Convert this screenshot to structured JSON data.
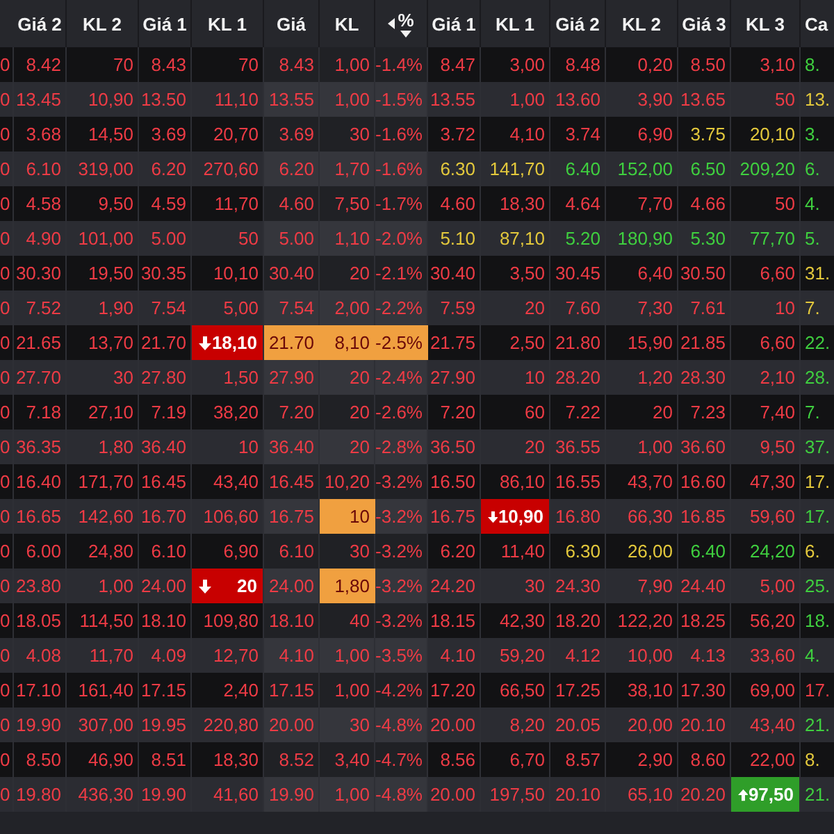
{
  "columns": [
    {},
    {
      "label": "Giá 2"
    },
    {
      "label": "KL 2"
    },
    {
      "label": "Giá 1"
    },
    {
      "label": "KL 1"
    },
    {
      "label": "Giá"
    },
    {
      "label": "KL"
    },
    {
      "label": "%",
      "sorted": true
    },
    {
      "label": "Giá 1"
    },
    {
      "label": "KL 1"
    },
    {
      "label": "Giá 2"
    },
    {
      "label": "KL 2"
    },
    {
      "label": "Giá 3"
    },
    {
      "label": "KL 3"
    },
    {
      "label": "Ca"
    }
  ],
  "rows": [
    {
      "cells": [
        {
          "text": "0",
          "kind": "down"
        },
        {
          "text": "8.42",
          "kind": "down"
        },
        {
          "text": "70",
          "kind": "down"
        },
        {
          "text": "8.43",
          "kind": "down"
        },
        {
          "text": "70",
          "kind": "down"
        },
        {
          "text": "8.43",
          "kind": "down"
        },
        {
          "text": "1,00",
          "kind": "down"
        },
        {
          "text": "-1.4%",
          "kind": "down"
        },
        {
          "text": "8.47",
          "kind": "down"
        },
        {
          "text": "3,00",
          "kind": "down"
        },
        {
          "text": "8.48",
          "kind": "down"
        },
        {
          "text": "0,20",
          "kind": "down"
        },
        {
          "text": "8.50",
          "kind": "down"
        },
        {
          "text": "3,10",
          "kind": "down"
        },
        {
          "text": "8.",
          "kind": "up"
        }
      ]
    },
    {
      "cells": [
        {
          "text": "0",
          "kind": "down"
        },
        {
          "text": "13.45",
          "kind": "down"
        },
        {
          "text": "10,90",
          "kind": "down"
        },
        {
          "text": "13.50",
          "kind": "down"
        },
        {
          "text": "11,10",
          "kind": "down"
        },
        {
          "text": "13.55",
          "kind": "down"
        },
        {
          "text": "1,00",
          "kind": "down"
        },
        {
          "text": "-1.5%",
          "kind": "down"
        },
        {
          "text": "13.55",
          "kind": "down"
        },
        {
          "text": "1,00",
          "kind": "down"
        },
        {
          "text": "13.60",
          "kind": "down"
        },
        {
          "text": "3,90",
          "kind": "down"
        },
        {
          "text": "13.65",
          "kind": "down"
        },
        {
          "text": "50",
          "kind": "down"
        },
        {
          "text": "13.",
          "kind": "ref"
        }
      ]
    },
    {
      "cells": [
        {
          "text": "0",
          "kind": "down"
        },
        {
          "text": "3.68",
          "kind": "down"
        },
        {
          "text": "14,50",
          "kind": "down"
        },
        {
          "text": "3.69",
          "kind": "down"
        },
        {
          "text": "20,70",
          "kind": "down"
        },
        {
          "text": "3.69",
          "kind": "down"
        },
        {
          "text": "30",
          "kind": "down"
        },
        {
          "text": "-1.6%",
          "kind": "down"
        },
        {
          "text": "3.72",
          "kind": "down"
        },
        {
          "text": "4,10",
          "kind": "down"
        },
        {
          "text": "3.74",
          "kind": "down"
        },
        {
          "text": "6,90",
          "kind": "down"
        },
        {
          "text": "3.75",
          "kind": "ref"
        },
        {
          "text": "20,10",
          "kind": "ref"
        },
        {
          "text": "3.",
          "kind": "up"
        }
      ]
    },
    {
      "cells": [
        {
          "text": "0",
          "kind": "down"
        },
        {
          "text": "6.10",
          "kind": "down"
        },
        {
          "text": "319,00",
          "kind": "down"
        },
        {
          "text": "6.20",
          "kind": "down"
        },
        {
          "text": "270,60",
          "kind": "down"
        },
        {
          "text": "6.20",
          "kind": "down"
        },
        {
          "text": "1,70",
          "kind": "down"
        },
        {
          "text": "-1.6%",
          "kind": "down"
        },
        {
          "text": "6.30",
          "kind": "ref"
        },
        {
          "text": "141,70",
          "kind": "ref"
        },
        {
          "text": "6.40",
          "kind": "up"
        },
        {
          "text": "152,00",
          "kind": "up"
        },
        {
          "text": "6.50",
          "kind": "up"
        },
        {
          "text": "209,20",
          "kind": "up"
        },
        {
          "text": "6.",
          "kind": "up"
        }
      ]
    },
    {
      "cells": [
        {
          "text": "0",
          "kind": "down"
        },
        {
          "text": "4.58",
          "kind": "down"
        },
        {
          "text": "9,50",
          "kind": "down"
        },
        {
          "text": "4.59",
          "kind": "down"
        },
        {
          "text": "11,70",
          "kind": "down"
        },
        {
          "text": "4.60",
          "kind": "down"
        },
        {
          "text": "7,50",
          "kind": "down"
        },
        {
          "text": "-1.7%",
          "kind": "down"
        },
        {
          "text": "4.60",
          "kind": "down"
        },
        {
          "text": "18,30",
          "kind": "down"
        },
        {
          "text": "4.64",
          "kind": "down"
        },
        {
          "text": "7,70",
          "kind": "down"
        },
        {
          "text": "4.66",
          "kind": "down"
        },
        {
          "text": "50",
          "kind": "down"
        },
        {
          "text": "4.",
          "kind": "up"
        }
      ]
    },
    {
      "cells": [
        {
          "text": "0",
          "kind": "down"
        },
        {
          "text": "4.90",
          "kind": "down"
        },
        {
          "text": "101,00",
          "kind": "down"
        },
        {
          "text": "5.00",
          "kind": "down"
        },
        {
          "text": "50",
          "kind": "down"
        },
        {
          "text": "5.00",
          "kind": "down"
        },
        {
          "text": "1,10",
          "kind": "down"
        },
        {
          "text": "-2.0%",
          "kind": "down"
        },
        {
          "text": "5.10",
          "kind": "ref"
        },
        {
          "text": "87,10",
          "kind": "ref"
        },
        {
          "text": "5.20",
          "kind": "up"
        },
        {
          "text": "180,90",
          "kind": "up"
        },
        {
          "text": "5.30",
          "kind": "up"
        },
        {
          "text": "77,70",
          "kind": "up"
        },
        {
          "text": "5.",
          "kind": "up"
        }
      ]
    },
    {
      "cells": [
        {
          "text": "0",
          "kind": "down"
        },
        {
          "text": "30.30",
          "kind": "down"
        },
        {
          "text": "19,50",
          "kind": "down"
        },
        {
          "text": "30.35",
          "kind": "down"
        },
        {
          "text": "10,10",
          "kind": "down"
        },
        {
          "text": "30.40",
          "kind": "down"
        },
        {
          "text": "20",
          "kind": "down"
        },
        {
          "text": "-2.1%",
          "kind": "down"
        },
        {
          "text": "30.40",
          "kind": "down"
        },
        {
          "text": "3,50",
          "kind": "down"
        },
        {
          "text": "30.45",
          "kind": "down"
        },
        {
          "text": "6,40",
          "kind": "down"
        },
        {
          "text": "30.50",
          "kind": "down"
        },
        {
          "text": "6,60",
          "kind": "down"
        },
        {
          "text": "31.",
          "kind": "ref"
        }
      ]
    },
    {
      "cells": [
        {
          "text": "0",
          "kind": "down"
        },
        {
          "text": "7.52",
          "kind": "down"
        },
        {
          "text": "1,90",
          "kind": "down"
        },
        {
          "text": "7.54",
          "kind": "down"
        },
        {
          "text": "5,00",
          "kind": "down"
        },
        {
          "text": "7.54",
          "kind": "down"
        },
        {
          "text": "2,00",
          "kind": "down"
        },
        {
          "text": "-2.2%",
          "kind": "down"
        },
        {
          "text": "7.59",
          "kind": "down"
        },
        {
          "text": "20",
          "kind": "down"
        },
        {
          "text": "7.60",
          "kind": "down"
        },
        {
          "text": "7,30",
          "kind": "down"
        },
        {
          "text": "7.61",
          "kind": "down"
        },
        {
          "text": "10",
          "kind": "down"
        },
        {
          "text": "7.",
          "kind": "ref"
        }
      ]
    },
    {
      "cells": [
        {
          "text": "0",
          "kind": "down"
        },
        {
          "text": "21.65",
          "kind": "down"
        },
        {
          "text": "13,70",
          "kind": "down"
        },
        {
          "text": "21.70",
          "kind": "down"
        },
        {
          "text": "18,10",
          "kind": "sellflash"
        },
        {
          "text": "21.70",
          "kind": "matched"
        },
        {
          "text": "8,10",
          "kind": "matched"
        },
        {
          "text": "-2.5%",
          "kind": "matched"
        },
        {
          "text": "21.75",
          "kind": "down"
        },
        {
          "text": "2,50",
          "kind": "down"
        },
        {
          "text": "21.80",
          "kind": "down"
        },
        {
          "text": "15,90",
          "kind": "down"
        },
        {
          "text": "21.85",
          "kind": "down"
        },
        {
          "text": "6,60",
          "kind": "down"
        },
        {
          "text": "22.",
          "kind": "up"
        }
      ]
    },
    {
      "cells": [
        {
          "text": "0",
          "kind": "down"
        },
        {
          "text": "27.70",
          "kind": "down"
        },
        {
          "text": "30",
          "kind": "down"
        },
        {
          "text": "27.80",
          "kind": "down"
        },
        {
          "text": "1,50",
          "kind": "down"
        },
        {
          "text": "27.90",
          "kind": "down"
        },
        {
          "text": "20",
          "kind": "down"
        },
        {
          "text": "-2.4%",
          "kind": "down"
        },
        {
          "text": "27.90",
          "kind": "down"
        },
        {
          "text": "10",
          "kind": "down"
        },
        {
          "text": "28.20",
          "kind": "down"
        },
        {
          "text": "1,20",
          "kind": "down"
        },
        {
          "text": "28.30",
          "kind": "down"
        },
        {
          "text": "2,10",
          "kind": "down"
        },
        {
          "text": "28.",
          "kind": "up"
        }
      ]
    },
    {
      "cells": [
        {
          "text": "0",
          "kind": "down"
        },
        {
          "text": "7.18",
          "kind": "down"
        },
        {
          "text": "27,10",
          "kind": "down"
        },
        {
          "text": "7.19",
          "kind": "down"
        },
        {
          "text": "38,20",
          "kind": "down"
        },
        {
          "text": "7.20",
          "kind": "down"
        },
        {
          "text": "20",
          "kind": "down"
        },
        {
          "text": "-2.6%",
          "kind": "down"
        },
        {
          "text": "7.20",
          "kind": "down"
        },
        {
          "text": "60",
          "kind": "down"
        },
        {
          "text": "7.22",
          "kind": "down"
        },
        {
          "text": "20",
          "kind": "down"
        },
        {
          "text": "7.23",
          "kind": "down"
        },
        {
          "text": "7,40",
          "kind": "down"
        },
        {
          "text": "7.",
          "kind": "up"
        }
      ]
    },
    {
      "cells": [
        {
          "text": "0",
          "kind": "down"
        },
        {
          "text": "36.35",
          "kind": "down"
        },
        {
          "text": "1,80",
          "kind": "down"
        },
        {
          "text": "36.40",
          "kind": "down"
        },
        {
          "text": "10",
          "kind": "down"
        },
        {
          "text": "36.40",
          "kind": "down"
        },
        {
          "text": "20",
          "kind": "down"
        },
        {
          "text": "-2.8%",
          "kind": "down"
        },
        {
          "text": "36.50",
          "kind": "down"
        },
        {
          "text": "20",
          "kind": "down"
        },
        {
          "text": "36.55",
          "kind": "down"
        },
        {
          "text": "1,00",
          "kind": "down"
        },
        {
          "text": "36.60",
          "kind": "down"
        },
        {
          "text": "9,50",
          "kind": "down"
        },
        {
          "text": "37.",
          "kind": "up"
        }
      ]
    },
    {
      "cells": [
        {
          "text": "0",
          "kind": "down"
        },
        {
          "text": "16.40",
          "kind": "down"
        },
        {
          "text": "171,70",
          "kind": "down"
        },
        {
          "text": "16.45",
          "kind": "down"
        },
        {
          "text": "43,40",
          "kind": "down"
        },
        {
          "text": "16.45",
          "kind": "down"
        },
        {
          "text": "10,20",
          "kind": "down"
        },
        {
          "text": "-3.2%",
          "kind": "down"
        },
        {
          "text": "16.50",
          "kind": "down"
        },
        {
          "text": "86,10",
          "kind": "down"
        },
        {
          "text": "16.55",
          "kind": "down"
        },
        {
          "text": "43,70",
          "kind": "down"
        },
        {
          "text": "16.60",
          "kind": "down"
        },
        {
          "text": "47,30",
          "kind": "down"
        },
        {
          "text": "17.",
          "kind": "ref"
        }
      ]
    },
    {
      "cells": [
        {
          "text": "0",
          "kind": "down"
        },
        {
          "text": "16.65",
          "kind": "down"
        },
        {
          "text": "142,60",
          "kind": "down"
        },
        {
          "text": "16.70",
          "kind": "down"
        },
        {
          "text": "106,60",
          "kind": "down"
        },
        {
          "text": "16.75",
          "kind": "down"
        },
        {
          "text": "10",
          "kind": "matched"
        },
        {
          "text": "-3.2%",
          "kind": "down"
        },
        {
          "text": "16.75",
          "kind": "down"
        },
        {
          "text": "10,90",
          "kind": "sellflash"
        },
        {
          "text": "16.80",
          "kind": "down"
        },
        {
          "text": "66,30",
          "kind": "down"
        },
        {
          "text": "16.85",
          "kind": "down"
        },
        {
          "text": "59,60",
          "kind": "down"
        },
        {
          "text": "17.",
          "kind": "up"
        }
      ]
    },
    {
      "cells": [
        {
          "text": "0",
          "kind": "down"
        },
        {
          "text": "6.00",
          "kind": "down"
        },
        {
          "text": "24,80",
          "kind": "down"
        },
        {
          "text": "6.10",
          "kind": "down"
        },
        {
          "text": "6,90",
          "kind": "down"
        },
        {
          "text": "6.10",
          "kind": "down"
        },
        {
          "text": "30",
          "kind": "down"
        },
        {
          "text": "-3.2%",
          "kind": "down"
        },
        {
          "text": "6.20",
          "kind": "down"
        },
        {
          "text": "11,40",
          "kind": "down"
        },
        {
          "text": "6.30",
          "kind": "ref"
        },
        {
          "text": "26,00",
          "kind": "ref"
        },
        {
          "text": "6.40",
          "kind": "up"
        },
        {
          "text": "24,20",
          "kind": "up"
        },
        {
          "text": "6.",
          "kind": "ref"
        }
      ]
    },
    {
      "cells": [
        {
          "text": "0",
          "kind": "down"
        },
        {
          "text": "23.80",
          "kind": "down"
        },
        {
          "text": "1,00",
          "kind": "down"
        },
        {
          "text": "24.00",
          "kind": "down"
        },
        {
          "text": "20",
          "kind": "sellflash"
        },
        {
          "text": "24.00",
          "kind": "down"
        },
        {
          "text": "1,80",
          "kind": "matched"
        },
        {
          "text": "-3.2%",
          "kind": "down"
        },
        {
          "text": "24.20",
          "kind": "down"
        },
        {
          "text": "30",
          "kind": "down"
        },
        {
          "text": "24.30",
          "kind": "down"
        },
        {
          "text": "7,90",
          "kind": "down"
        },
        {
          "text": "24.40",
          "kind": "down"
        },
        {
          "text": "5,00",
          "kind": "down"
        },
        {
          "text": "25.",
          "kind": "up"
        }
      ]
    },
    {
      "cells": [
        {
          "text": "0",
          "kind": "down"
        },
        {
          "text": "18.05",
          "kind": "down"
        },
        {
          "text": "114,50",
          "kind": "down"
        },
        {
          "text": "18.10",
          "kind": "down"
        },
        {
          "text": "109,80",
          "kind": "down"
        },
        {
          "text": "18.10",
          "kind": "down"
        },
        {
          "text": "40",
          "kind": "down"
        },
        {
          "text": "-3.2%",
          "kind": "down"
        },
        {
          "text": "18.15",
          "kind": "down"
        },
        {
          "text": "42,30",
          "kind": "down"
        },
        {
          "text": "18.20",
          "kind": "down"
        },
        {
          "text": "122,20",
          "kind": "down"
        },
        {
          "text": "18.25",
          "kind": "down"
        },
        {
          "text": "56,20",
          "kind": "down"
        },
        {
          "text": "18.",
          "kind": "up"
        }
      ]
    },
    {
      "cells": [
        {
          "text": "0",
          "kind": "down"
        },
        {
          "text": "4.08",
          "kind": "down"
        },
        {
          "text": "11,70",
          "kind": "down"
        },
        {
          "text": "4.09",
          "kind": "down"
        },
        {
          "text": "12,70",
          "kind": "down"
        },
        {
          "text": "4.10",
          "kind": "down"
        },
        {
          "text": "1,00",
          "kind": "down"
        },
        {
          "text": "-3.5%",
          "kind": "down"
        },
        {
          "text": "4.10",
          "kind": "down"
        },
        {
          "text": "59,20",
          "kind": "down"
        },
        {
          "text": "4.12",
          "kind": "down"
        },
        {
          "text": "10,00",
          "kind": "down"
        },
        {
          "text": "4.13",
          "kind": "down"
        },
        {
          "text": "33,60",
          "kind": "down"
        },
        {
          "text": "4.",
          "kind": "up"
        }
      ]
    },
    {
      "cells": [
        {
          "text": "0",
          "kind": "down"
        },
        {
          "text": "17.10",
          "kind": "down"
        },
        {
          "text": "161,40",
          "kind": "down"
        },
        {
          "text": "17.15",
          "kind": "down"
        },
        {
          "text": "2,40",
          "kind": "down"
        },
        {
          "text": "17.15",
          "kind": "down"
        },
        {
          "text": "1,00",
          "kind": "down"
        },
        {
          "text": "-4.2%",
          "kind": "down"
        },
        {
          "text": "17.20",
          "kind": "down"
        },
        {
          "text": "66,50",
          "kind": "down"
        },
        {
          "text": "17.25",
          "kind": "down"
        },
        {
          "text": "38,10",
          "kind": "down"
        },
        {
          "text": "17.30",
          "kind": "down"
        },
        {
          "text": "69,00",
          "kind": "down"
        },
        {
          "text": "17.",
          "kind": "down"
        }
      ]
    },
    {
      "cells": [
        {
          "text": "0",
          "kind": "down"
        },
        {
          "text": "19.90",
          "kind": "down"
        },
        {
          "text": "307,00",
          "kind": "down"
        },
        {
          "text": "19.95",
          "kind": "down"
        },
        {
          "text": "220,80",
          "kind": "down"
        },
        {
          "text": "20.00",
          "kind": "down"
        },
        {
          "text": "30",
          "kind": "down"
        },
        {
          "text": "-4.8%",
          "kind": "down"
        },
        {
          "text": "20.00",
          "kind": "down"
        },
        {
          "text": "8,20",
          "kind": "down"
        },
        {
          "text": "20.05",
          "kind": "down"
        },
        {
          "text": "20,00",
          "kind": "down"
        },
        {
          "text": "20.10",
          "kind": "down"
        },
        {
          "text": "43,40",
          "kind": "down"
        },
        {
          "text": "21.",
          "kind": "up"
        }
      ]
    },
    {
      "cells": [
        {
          "text": "0",
          "kind": "down"
        },
        {
          "text": "8.50",
          "kind": "down"
        },
        {
          "text": "46,90",
          "kind": "down"
        },
        {
          "text": "8.51",
          "kind": "down"
        },
        {
          "text": "18,30",
          "kind": "down"
        },
        {
          "text": "8.52",
          "kind": "down"
        },
        {
          "text": "3,40",
          "kind": "down"
        },
        {
          "text": "-4.7%",
          "kind": "down"
        },
        {
          "text": "8.56",
          "kind": "down"
        },
        {
          "text": "6,70",
          "kind": "down"
        },
        {
          "text": "8.57",
          "kind": "down"
        },
        {
          "text": "2,90",
          "kind": "down"
        },
        {
          "text": "8.60",
          "kind": "down"
        },
        {
          "text": "22,00",
          "kind": "down"
        },
        {
          "text": "8.",
          "kind": "ref"
        }
      ]
    },
    {
      "cells": [
        {
          "text": "0",
          "kind": "down"
        },
        {
          "text": "19.80",
          "kind": "down"
        },
        {
          "text": "436,30",
          "kind": "down"
        },
        {
          "text": "19.90",
          "kind": "down"
        },
        {
          "text": "41,60",
          "kind": "down"
        },
        {
          "text": "19.90",
          "kind": "down"
        },
        {
          "text": "1,00",
          "kind": "down"
        },
        {
          "text": "-4.8%",
          "kind": "down"
        },
        {
          "text": "20.00",
          "kind": "down"
        },
        {
          "text": "197,50",
          "kind": "down"
        },
        {
          "text": "20.10",
          "kind": "down"
        },
        {
          "text": "65,10",
          "kind": "down"
        },
        {
          "text": "20.20",
          "kind": "down"
        },
        {
          "text": "97,50",
          "kind": "buyflash"
        },
        {
          "text": "21.",
          "kind": "up"
        }
      ]
    }
  ]
}
